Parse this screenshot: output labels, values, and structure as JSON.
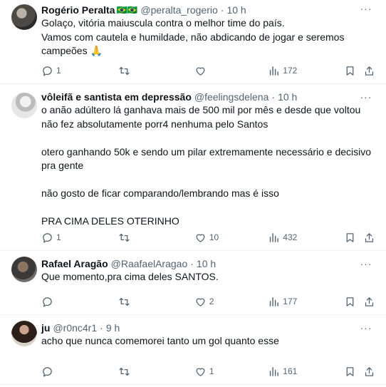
{
  "tweets": [
    {
      "name": "Rogério Peralta",
      "flags": "🇧🇷🇧🇷",
      "handle": "@peralta_rogerio",
      "time": "10 h",
      "body": "Golaço,  vitória maiuscula contra o melhor time do país.\nVamos com cautela e humildade, não abdicando de jogar e seremos campeões 🙏",
      "replies": "1",
      "retweets": "",
      "likes": "",
      "views": "172"
    },
    {
      "name": "vôleifã e santista em depressão",
      "flags": "",
      "handle": "@feelingsdelena",
      "time": "10 h",
      "body": "o anão adúltero lá ganhava mais de 500 mil por mês e desde que voltou não fez absolutamente porr4 nenhuma pelo Santos\n\notero ganhando 50k e sendo um pilar extremamente necessário e decisivo pra gente\n\nnão gosto de ficar comparando/lembrando mas é isso\n\nPRA CIMA DELES OTERINHO",
      "replies": "1",
      "retweets": "",
      "likes": "10",
      "views": "432"
    },
    {
      "name": "Rafael Aragão",
      "flags": "",
      "handle": "@RaafaelAragao",
      "time": "10 h",
      "body": "Que momento,pra cima deles SANTOS.",
      "replies": "",
      "retweets": "",
      "likes": "2",
      "views": "177"
    },
    {
      "name": "ju",
      "flags": "",
      "handle": "@r0nc4r1",
      "time": "9 h",
      "body": "acho que nunca comemorei tanto um gol quanto esse",
      "replies": "",
      "retweets": "",
      "likes": "1",
      "views": "161"
    }
  ],
  "separator": "·",
  "more_label": "···",
  "colors": {
    "secondary": "#536471",
    "text": "#0f1419",
    "divider": "#eff3f4"
  },
  "icons": [
    "reply-icon",
    "retweet-icon",
    "like-icon",
    "views-icon",
    "bookmark-icon",
    "share-icon",
    "more-icon"
  ]
}
